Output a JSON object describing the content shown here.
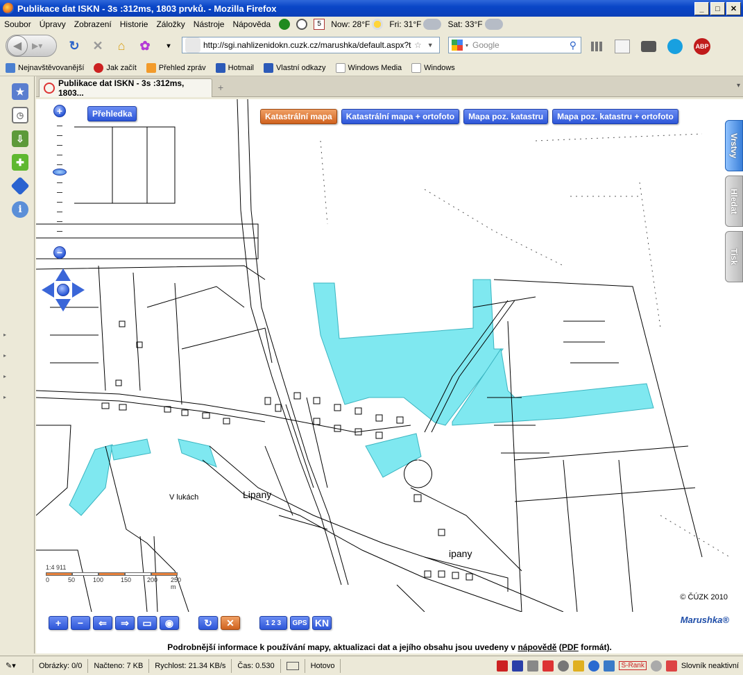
{
  "window": {
    "title": "Publikace dat ISKN - 3s :312ms, 1803 prvků. - Mozilla Firefox"
  },
  "menu": {
    "items": [
      "Soubor",
      "Úpravy",
      "Zobrazení",
      "Historie",
      "Záložky",
      "Nástroje",
      "Nápověda"
    ],
    "weather": {
      "now": "Now: 28°F",
      "fri": "Fri: 31°F",
      "sat": "Sat: 33°F"
    },
    "calendar_day": "5"
  },
  "nav": {
    "url": "http://sgi.nahlizenidokn.cuzk.cz/marushka/default.aspx?theme",
    "search_placeholder": "Google"
  },
  "bookmarks": [
    "Nejnavštěvovanější",
    "Jak začít",
    "Přehled zpráv",
    "Hotmail",
    "Vlastní odkazy",
    "Windows Media",
    "Windows"
  ],
  "tab": {
    "title": "Publikace dat ISKN - 3s :312ms, 1803..."
  },
  "map": {
    "overview_button": "Přehledka",
    "layer_buttons": [
      "Katastrální mapa",
      "Katastrální mapa + ortofoto",
      "Mapa poz. katastru",
      "Mapa poz. katastru + ortofoto"
    ],
    "active_layer_index": 0,
    "side_tabs": [
      "Vrstvy",
      "Hledat",
      "Tisk"
    ],
    "place_labels": {
      "v_lukach": "V lukách",
      "lipany": "Lipany",
      "lipany2": "ipany"
    },
    "scale": {
      "ratio": "1:4 911",
      "labels": [
        "0",
        "50",
        "100",
        "150",
        "200",
        "250 m"
      ]
    },
    "copyright": "© ČÚZK 2010",
    "highlight_color": "#7fe8f0"
  },
  "toolbar": {
    "brand": "Marushka®",
    "gps": "GPS",
    "kn": "KN",
    "numbers": "1 2 3",
    "info_pre": "Podrobnější informace k používání mapy, aktualizaci dat a jejího obsahu jsou uvedeny v",
    "info_link1": "nápovědě",
    "info_mid": "(",
    "info_link2": "PDF",
    "info_post": "formát)."
  },
  "status": {
    "images": "Obrázky: 0/0",
    "loaded": "Načteno: 7 KB",
    "speed": "Rychlost: 21.34 KB/s",
    "time": "Čas: 0.530",
    "done": "Hotovo",
    "srank": "S-Rank",
    "dictionary": "Slovník neaktivní"
  }
}
